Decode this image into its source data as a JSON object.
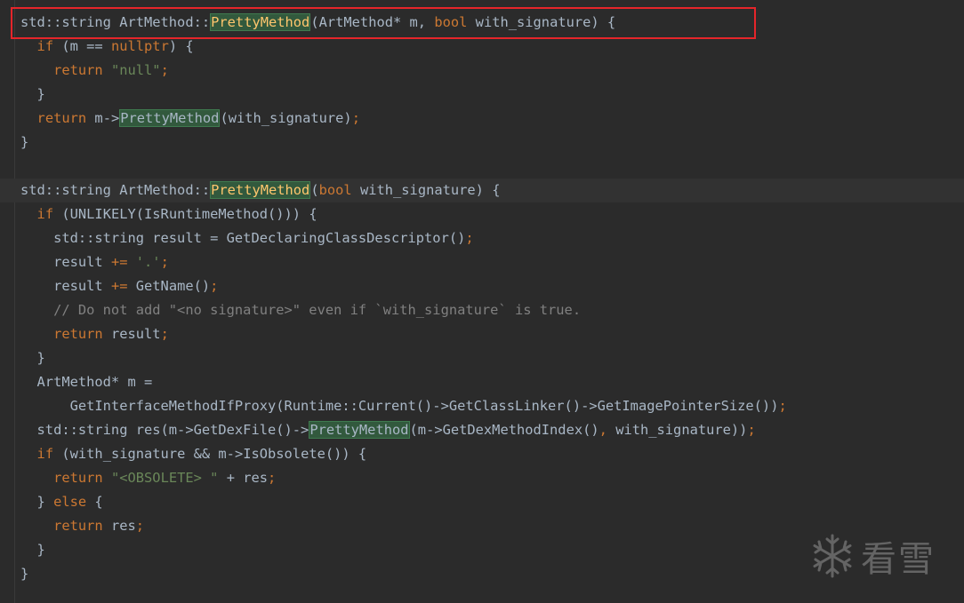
{
  "editor": {
    "lines": [
      [
        [
          "tx",
          "std::string ArtMethod::"
        ],
        [
          "hl-def",
          "PrettyMethod"
        ],
        [
          "tx",
          "(ArtMethod* m, "
        ],
        [
          "kw",
          "bool"
        ],
        [
          "tx",
          " with_signature) {"
        ]
      ],
      [
        [
          "tx",
          "  "
        ],
        [
          "kw",
          "if"
        ],
        [
          "tx",
          " (m == "
        ],
        [
          "kw",
          "nullptr"
        ],
        [
          "tx",
          ") {"
        ]
      ],
      [
        [
          "tx",
          "    "
        ],
        [
          "kw",
          "return"
        ],
        [
          "tx",
          " "
        ],
        [
          "str",
          "\"null\""
        ],
        [
          "kw",
          ";"
        ]
      ],
      [
        [
          "tx",
          "  }"
        ]
      ],
      [
        [
          "tx",
          "  "
        ],
        [
          "kw",
          "return"
        ],
        [
          "tx",
          " m->"
        ],
        [
          "hl-use",
          "PrettyMethod"
        ],
        [
          "tx",
          "(with_signature)"
        ],
        [
          "kw",
          ";"
        ]
      ],
      [
        [
          "tx",
          "}"
        ]
      ],
      [
        [
          "tx",
          ""
        ]
      ],
      [
        [
          "tx",
          "std::string ArtMethod::"
        ],
        [
          "hl-def",
          "PrettyMethod"
        ],
        [
          "tx",
          "("
        ],
        [
          "kw",
          "bool"
        ],
        [
          "tx",
          " with_signature) {"
        ]
      ],
      [
        [
          "tx",
          "  "
        ],
        [
          "kw",
          "if"
        ],
        [
          "tx",
          " (UNLIKELY(IsRuntimeMethod())) {"
        ]
      ],
      [
        [
          "tx",
          "    std::string result = GetDeclaringClassDescriptor()"
        ],
        [
          "kw",
          ";"
        ]
      ],
      [
        [
          "tx",
          "    result "
        ],
        [
          "kw",
          "+="
        ],
        [
          "tx",
          " "
        ],
        [
          "str",
          "'.'"
        ],
        [
          "kw",
          ";"
        ]
      ],
      [
        [
          "tx",
          "    result "
        ],
        [
          "kw",
          "+="
        ],
        [
          "tx",
          " GetName()"
        ],
        [
          "kw",
          ";"
        ]
      ],
      [
        [
          "cm",
          "    // Do not add \"<no signature>\" even if `with_signature` is true."
        ]
      ],
      [
        [
          "tx",
          "    "
        ],
        [
          "kw",
          "return"
        ],
        [
          "tx",
          " result"
        ],
        [
          "kw",
          ";"
        ]
      ],
      [
        [
          "tx",
          "  }"
        ]
      ],
      [
        [
          "tx",
          "  ArtMethod* m ="
        ]
      ],
      [
        [
          "tx",
          "      GetInterfaceMethodIfProxy(Runtime::Current()->GetClassLinker()->GetImagePointerSize())"
        ],
        [
          "kw",
          ";"
        ]
      ],
      [
        [
          "tx",
          "  std::string res(m->GetDexFile()->"
        ],
        [
          "hl-use",
          "PrettyMethod"
        ],
        [
          "tx",
          "(m->GetDexMethodIndex()"
        ],
        [
          "kw",
          ","
        ],
        [
          "tx",
          " with_signature))"
        ],
        [
          "kw",
          ";"
        ]
      ],
      [
        [
          "tx",
          "  "
        ],
        [
          "kw",
          "if"
        ],
        [
          "tx",
          " (with_signature && m->IsObsolete()) {"
        ]
      ],
      [
        [
          "tx",
          "    "
        ],
        [
          "kw",
          "return"
        ],
        [
          "tx",
          " "
        ],
        [
          "str",
          "\"<OBSOLETE> \""
        ],
        [
          "tx",
          " + res"
        ],
        [
          "kw",
          ";"
        ]
      ],
      [
        [
          "tx",
          "  } "
        ],
        [
          "kw",
          "else"
        ],
        [
          "tx",
          " {"
        ]
      ],
      [
        [
          "tx",
          "    "
        ],
        [
          "kw",
          "return"
        ],
        [
          "tx",
          " res"
        ],
        [
          "kw",
          ";"
        ]
      ],
      [
        [
          "tx",
          "  }"
        ]
      ],
      [
        [
          "tx",
          "}"
        ]
      ]
    ],
    "current_line_index": 7
  },
  "watermark": {
    "text": "看雪",
    "icon": "snowflake-icon"
  },
  "colors": {
    "background": "#2b2b2b",
    "keyword": "#cc7832",
    "function_decl": "#ffc66d",
    "string": "#6a8759",
    "comment": "#808080",
    "text": "#a9b7c6",
    "usage_highlight": "#32593d",
    "annotation_box": "#e5252a"
  }
}
